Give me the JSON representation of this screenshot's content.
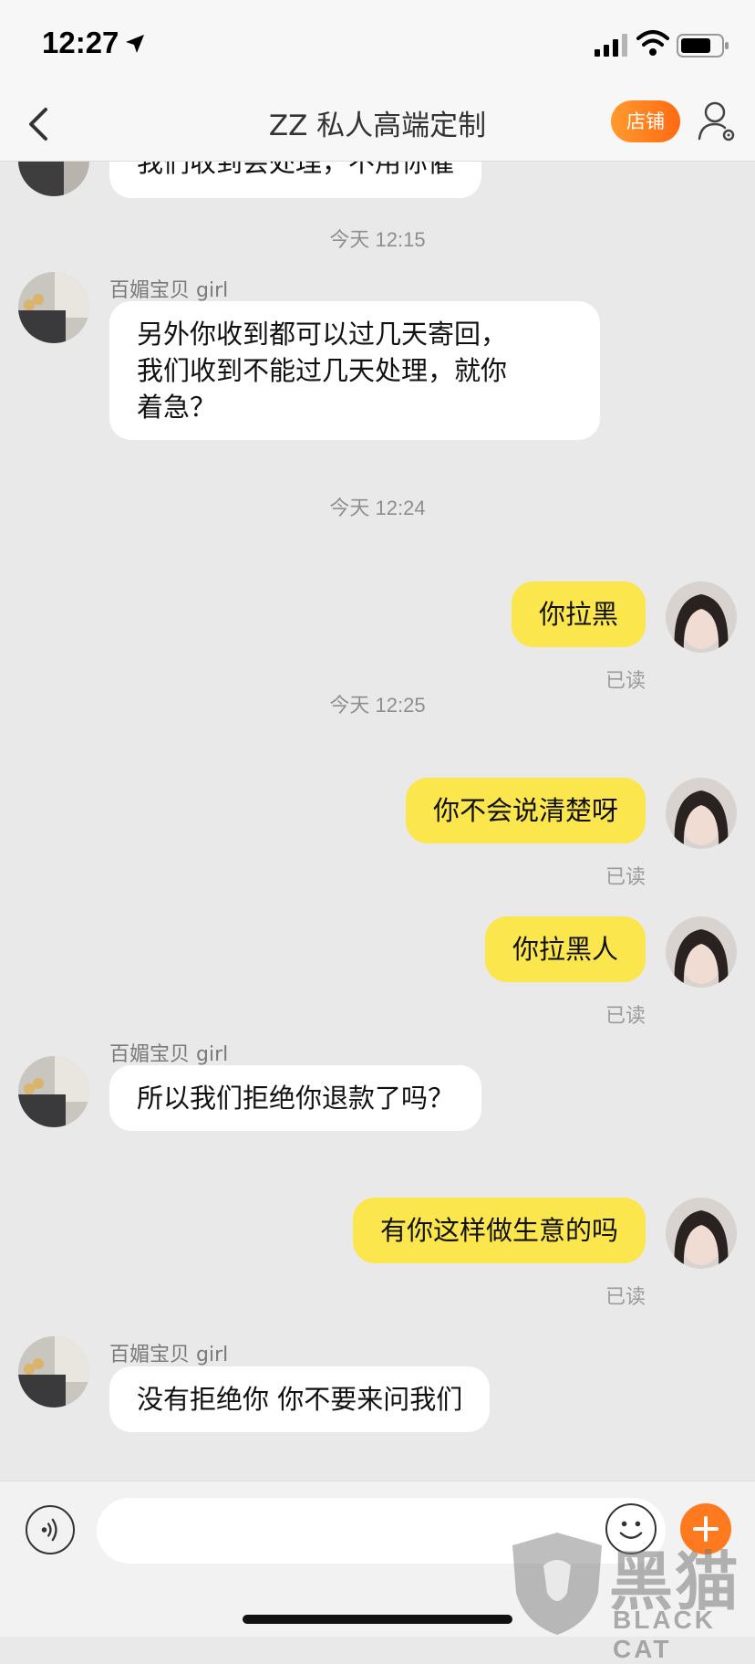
{
  "status_bar": {
    "time": "12:27"
  },
  "nav": {
    "title": "ZZ 私人高端定制",
    "shop_label": "店铺"
  },
  "chat": {
    "m0": "我们收到会处理，不用你催",
    "t1": "今天 12:15",
    "sender1": "百媚宝贝 girl",
    "m1": "另外你收到都可以过几天寄回，\n我们收到不能过几天处理，就你\n着急？",
    "t2": "今天 12:24",
    "m2": "你拉黑",
    "r2": "已读",
    "t3": "今天 12:25",
    "m3": "你不会说清楚呀",
    "r3": "已读",
    "m4": "你拉黑人",
    "r4": "已读",
    "sender5": "百媚宝贝 girl",
    "m5": "所以我们拒绝你退款了吗？",
    "m6": "有你这样做生意的吗",
    "r6": "已读",
    "sender7": "百媚宝贝 girl",
    "m7": "没有拒绝你 你不要来问我们"
  },
  "input_bar": {
    "value": "",
    "placeholder": ""
  },
  "watermark": {
    "word": "黑猫",
    "latin": "BLACK CAT"
  },
  "icons": {
    "back": "chevron-left-icon",
    "user_settings": "user-settings-icon",
    "voice": "voice-icon",
    "emoji": "emoji-icon",
    "plus": "plus-icon"
  },
  "colors": {
    "incoming_bubble": "#ffffff",
    "outgoing_bubble": "#fbe64e",
    "accent": "#ff7a1e",
    "chat_background": "#e9e9e9"
  }
}
